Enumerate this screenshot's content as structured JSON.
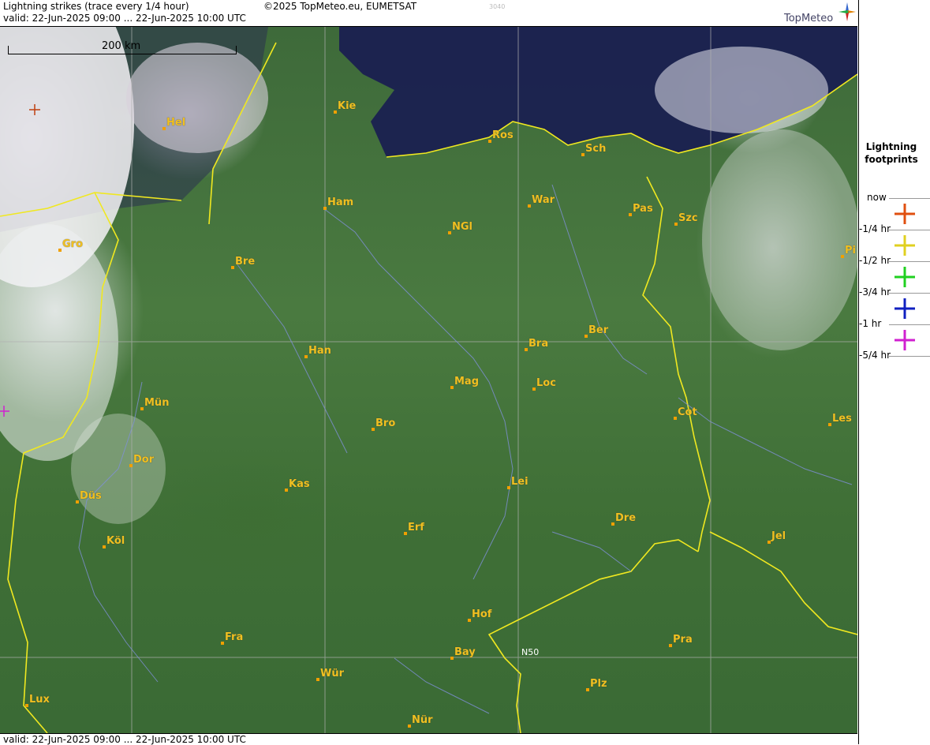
{
  "header": {
    "title": "Lightning strikes (trace every 1/4 hour)",
    "valid": "valid:  22-Jun-2025 09:00 ... 22-Jun-2025 10:00 UTC",
    "copyright": "©2025 TopMeteo.eu, EUMETSAT",
    "code": "3040",
    "logo": "TopMeteo"
  },
  "footer": {
    "valid": "valid:  22-Jun-2025 09:00 ... 22-Jun-2025 10:00 UTC"
  },
  "scale": {
    "label": "200 km"
  },
  "gridlabel": "N50",
  "legend": {
    "title1": "Lightning",
    "title2": "footprints",
    "items": [
      {
        "label": "now",
        "color": "#e05010"
      },
      {
        "label": "-1/4 hr",
        "color": "#e0d020"
      },
      {
        "label": "-1/2 hr",
        "color": "#20d020"
      },
      {
        "label": "-3/4 hr",
        "color": "#1020c0"
      },
      {
        "label": "-1 hr",
        "color": "#d020d0"
      },
      {
        "label": "-5/4 hr",
        "color": ""
      }
    ]
  },
  "cities": [
    {
      "name": "Kie"
    },
    {
      "name": "Hel"
    },
    {
      "name": "Ros"
    },
    {
      "name": "Sch"
    },
    {
      "name": "Ham"
    },
    {
      "name": "War"
    },
    {
      "name": "Pas"
    },
    {
      "name": "Szc"
    },
    {
      "name": "NGl"
    },
    {
      "name": "Gro"
    },
    {
      "name": "Bre"
    },
    {
      "name": "Pi"
    },
    {
      "name": "Ber"
    },
    {
      "name": "Bra"
    },
    {
      "name": "Han"
    },
    {
      "name": "Mag"
    },
    {
      "name": "Loc"
    },
    {
      "name": "Mün"
    },
    {
      "name": "Cot"
    },
    {
      "name": "Bro"
    },
    {
      "name": "Les"
    },
    {
      "name": "Dor"
    },
    {
      "name": "Kas"
    },
    {
      "name": "Lei"
    },
    {
      "name": "Düs"
    },
    {
      "name": "Erf"
    },
    {
      "name": "Dre"
    },
    {
      "name": "Köl"
    },
    {
      "name": "Jel"
    },
    {
      "name": "Hof"
    },
    {
      "name": "Fra"
    },
    {
      "name": "Pra"
    },
    {
      "name": "Bay"
    },
    {
      "name": "Wür"
    },
    {
      "name": "Plz"
    },
    {
      "name": "Lux"
    },
    {
      "name": "Nür"
    }
  ],
  "strikes": [
    {
      "color": "#c04010"
    },
    {
      "color": "#d020d0"
    }
  ]
}
